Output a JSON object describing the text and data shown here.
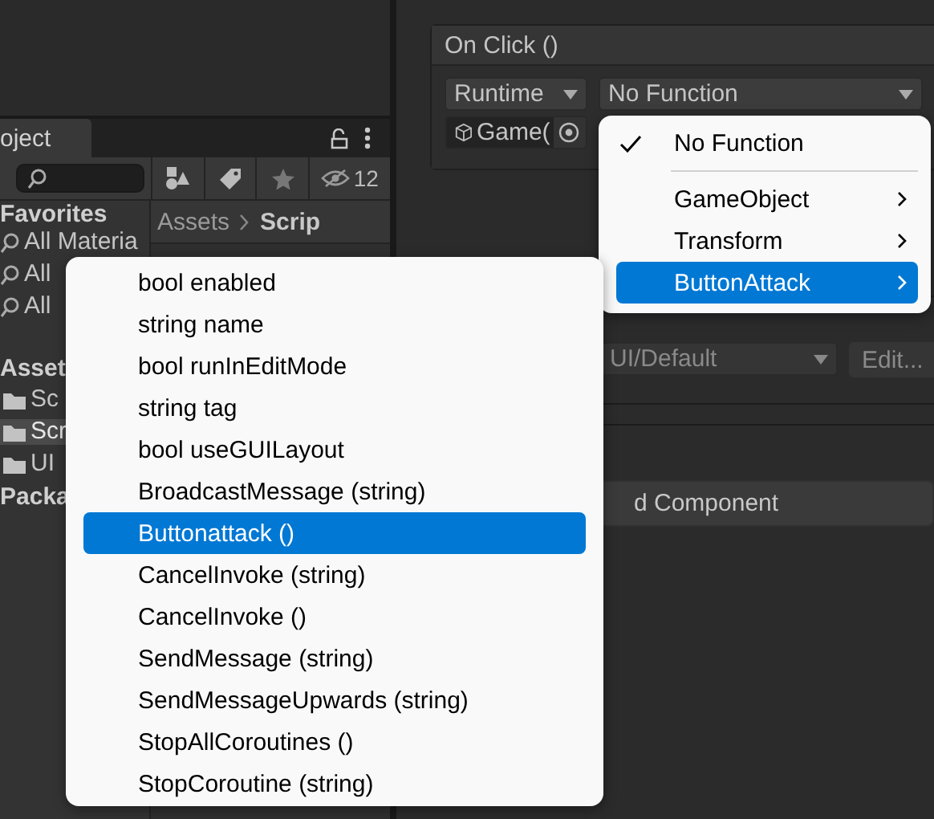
{
  "project_panel": {
    "tab": "oject",
    "hidden_count": "12",
    "favorites": {
      "title": "Favorites",
      "items": [
        {
          "label": "All Materia",
          "selected": false
        },
        {
          "label": "All",
          "selected": false
        },
        {
          "label": "All",
          "selected": false
        }
      ]
    },
    "assets": {
      "title": "Asset",
      "items": [
        {
          "label": "Sc",
          "selected": false
        },
        {
          "label": "Scr",
          "selected": true
        },
        {
          "label": "UI",
          "selected": false
        }
      ]
    },
    "packages": {
      "title": "Packa"
    },
    "breadcrumb": [
      "Assets",
      "Scrip"
    ]
  },
  "inspector": {
    "on_click": {
      "title": "On Click ()",
      "runtime": "Runtime",
      "function": "No Function",
      "object": "Game("
    },
    "shader": "UI/Default",
    "edit_button": "Edit...",
    "add_component": "d Component"
  },
  "function_menu": {
    "items": [
      {
        "kind": "item",
        "label": "No Function",
        "checked": true,
        "submenu": false,
        "selected": false
      },
      {
        "kind": "separator"
      },
      {
        "kind": "item",
        "label": "GameObject",
        "checked": false,
        "submenu": true,
        "selected": false
      },
      {
        "kind": "item",
        "label": "Transform",
        "checked": false,
        "submenu": true,
        "selected": false
      },
      {
        "kind": "item",
        "label": "ButtonAttack",
        "checked": false,
        "submenu": true,
        "selected": true
      }
    ]
  },
  "submenu": {
    "items": [
      {
        "label": "bool enabled",
        "selected": false
      },
      {
        "label": "string name",
        "selected": false
      },
      {
        "label": "bool runInEditMode",
        "selected": false
      },
      {
        "label": "string tag",
        "selected": false
      },
      {
        "label": "bool useGUILayout",
        "selected": false
      },
      {
        "label": "BroadcastMessage (string)",
        "selected": false
      },
      {
        "label": "Buttonattack ()",
        "selected": true
      },
      {
        "label": "CancelInvoke (string)",
        "selected": false
      },
      {
        "label": "CancelInvoke ()",
        "selected": false
      },
      {
        "label": "SendMessage (string)",
        "selected": false
      },
      {
        "label": "SendMessageUpwards (string)",
        "selected": false
      },
      {
        "label": "StopAllCoroutines ()",
        "selected": false
      },
      {
        "label": "StopCoroutine (string)",
        "selected": false
      }
    ]
  }
}
